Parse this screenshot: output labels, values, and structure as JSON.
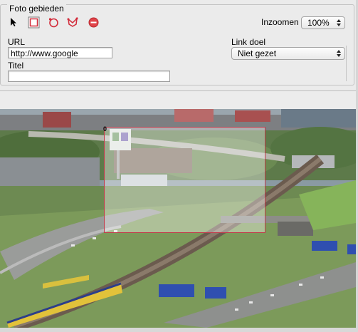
{
  "panel": {
    "legend": "Foto gebieden",
    "tools": [
      {
        "name": "pointer-icon"
      },
      {
        "name": "rectangle-icon"
      },
      {
        "name": "circle-icon"
      },
      {
        "name": "polygon-icon"
      },
      {
        "name": "delete-icon"
      }
    ],
    "zoom": {
      "label": "Inzoomen",
      "value": "100%"
    },
    "url": {
      "label": "URL",
      "value": "http://www.google"
    },
    "link_target": {
      "label": "Link doel",
      "value": "Niet gezet"
    },
    "title": {
      "label": "Titel",
      "value": ""
    }
  },
  "image": {
    "area_index": "0",
    "colors": {
      "selection_border": "#c23a4a",
      "delete_icon": "#e0444a"
    }
  }
}
